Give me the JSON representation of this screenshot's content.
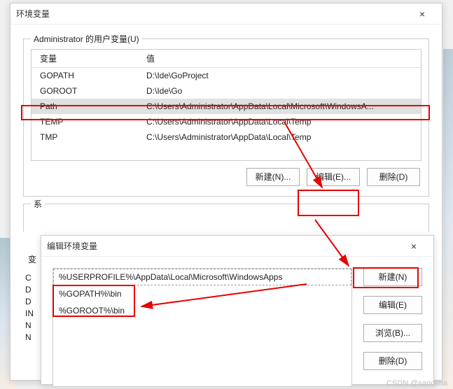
{
  "window1": {
    "title": "环境变量",
    "close_glyph": "×",
    "user_group_label": "Administrator 的用户变量(U)",
    "columns": {
      "var": "变量",
      "val": "值"
    },
    "rows": [
      {
        "var": "GOPATH",
        "val": "D:\\Ide\\GoProject"
      },
      {
        "var": "GOROOT",
        "val": "D:\\Ide\\Go"
      },
      {
        "var": "Path",
        "val": "C:\\Users\\Administrator\\AppData\\Local\\Microsoft\\WindowsA..."
      },
      {
        "var": "TEMP",
        "val": "C:\\Users\\Administrator\\AppData\\Local\\Temp"
      },
      {
        "var": "TMP",
        "val": "C:\\Users\\Administrator\\AppData\\Local\\Temp"
      }
    ],
    "buttons": {
      "new": "新建(N)...",
      "edit": "编辑(E)...",
      "delete": "删除(D)"
    },
    "sys_group_label": "系",
    "sys_col_var": "变",
    "sys_stubs": [
      "C",
      "D",
      "D",
      "IN",
      "N",
      "N"
    ]
  },
  "window2": {
    "title": "编辑环境变量",
    "close_glyph": "×",
    "list": [
      "%USERPROFILE%\\AppData\\Local\\Microsoft\\WindowsApps",
      "%GOPATH%\\bin",
      "%GOROOT%\\bin"
    ],
    "buttons": {
      "new": "新建(N)",
      "edit": "编辑(E)",
      "browse": "浏览(B)...",
      "delete": "删除(D)"
    }
  },
  "annotations": {
    "color": "#e60000"
  },
  "watermark": "CSDN @sanqima"
}
